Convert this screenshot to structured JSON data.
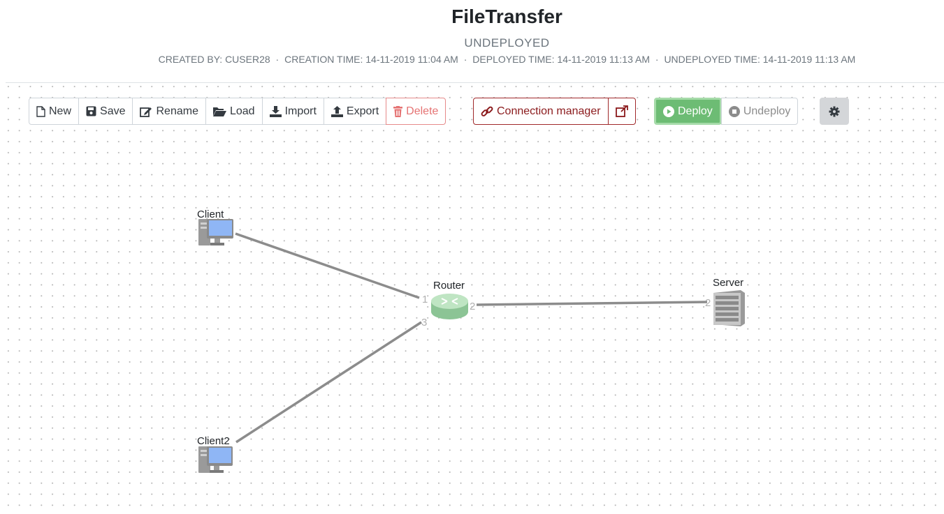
{
  "header": {
    "title": "FileTransfer",
    "status": "UNDEPLOYED",
    "created_by": "CREATED BY: CUSER28",
    "creation_time": "CREATION TIME: 14-11-2019 11:04 AM",
    "deployed_time": "DEPLOYED TIME: 14-11-2019 11:13 AM",
    "undeployed_time": "UNDEPLOYED TIME: 14-11-2019 11:13 AM",
    "separator": "·"
  },
  "toolbar": {
    "new_label": "New",
    "save_label": "Save",
    "rename_label": "Rename",
    "load_label": "Load",
    "import_label": "Import",
    "export_label": "Export",
    "delete_label": "Delete",
    "connection_manager_label": "Connection manager",
    "deploy_label": "Deploy",
    "undeploy_label": "Undeploy"
  },
  "topology": {
    "nodes": {
      "client": {
        "label": "Client"
      },
      "client2": {
        "label": "Client2"
      },
      "router": {
        "label": "Router"
      },
      "server": {
        "label": "Server"
      }
    },
    "ports": {
      "router_port_1": "1",
      "router_port_2": "2",
      "router_port_3": "3",
      "server_port_2": "2"
    }
  },
  "colors": {
    "deploy": "#6dbc74",
    "delete": "#e57373",
    "connection": "#8b1a1c",
    "link": "#8c8c8c",
    "router": "#9fd4a6"
  }
}
